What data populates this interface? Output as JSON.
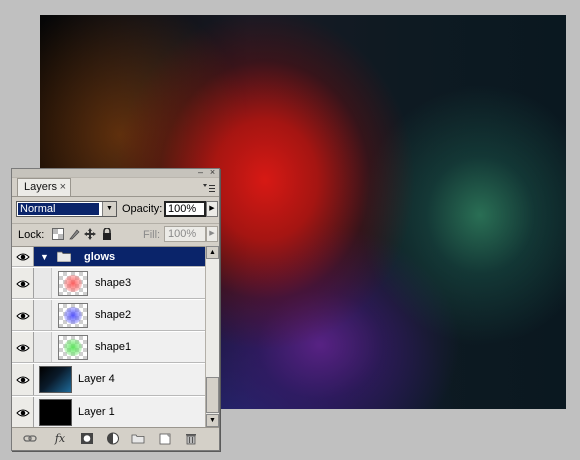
{
  "panel": {
    "tab_label": "Layers",
    "tab_close": "×",
    "minimize": "–",
    "close": "×",
    "menu_icon": "panel-menu-icon"
  },
  "options": {
    "blend_mode": "Normal",
    "opacity_label": "Opacity:",
    "opacity_value": "100%",
    "lock_label": "Lock:",
    "fill_label": "Fill:",
    "fill_value": "100%"
  },
  "layers": {
    "group": {
      "name": "glows",
      "expanded": true,
      "selected": true
    },
    "items": [
      {
        "name": "shape3",
        "in_group": true,
        "thumb_color": "#ff6b6b"
      },
      {
        "name": "shape2",
        "in_group": true,
        "thumb_color": "#5b5bff"
      },
      {
        "name": "shape1",
        "in_group": true,
        "thumb_color": "#6be86b"
      },
      {
        "name": "Layer 4",
        "in_group": false,
        "thumb_color": "#1a5a8a"
      },
      {
        "name": "Layer 1",
        "in_group": false,
        "thumb_color": "#000000"
      }
    ]
  },
  "bottom_icons": [
    "link-icon",
    "fx-icon",
    "mask-icon",
    "adjustment-icon",
    "folder-icon",
    "new-layer-icon",
    "trash-icon"
  ],
  "fx_label": "fx",
  "colors": {
    "selection": "#0a246a",
    "panel_bg": "#d4d0c8"
  }
}
